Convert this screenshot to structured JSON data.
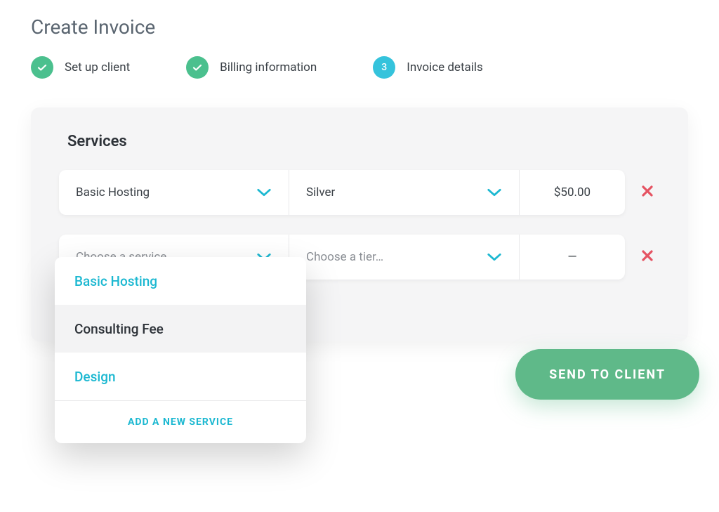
{
  "page": {
    "title": "Create Invoice"
  },
  "stepper": {
    "steps": [
      {
        "label": "Set up client",
        "status": "done"
      },
      {
        "label": "Billing information",
        "status": "done"
      },
      {
        "label": "Invoice details",
        "status": "active",
        "number": "3"
      }
    ]
  },
  "card": {
    "title": "Services"
  },
  "services": {
    "rows": [
      {
        "service": "Basic Hosting",
        "tier": "Silver",
        "price": "$50.00"
      },
      {
        "service_placeholder": "Choose a service…",
        "tier_placeholder": "Choose a tier…",
        "price": "—"
      }
    ]
  },
  "dropdown": {
    "options": [
      {
        "label": "Basic Hosting"
      },
      {
        "label": "Consulting Fee"
      },
      {
        "label": "Design"
      }
    ],
    "add_label": "ADD A NEW SERVICE"
  },
  "actions": {
    "send_label": "SEND TO CLIENT"
  },
  "colors": {
    "accent_green": "#4bc08e",
    "accent_cyan": "#35c3dc",
    "link_cyan": "#1cb8d1",
    "button_green": "#5fb989",
    "danger": "#e55362"
  }
}
